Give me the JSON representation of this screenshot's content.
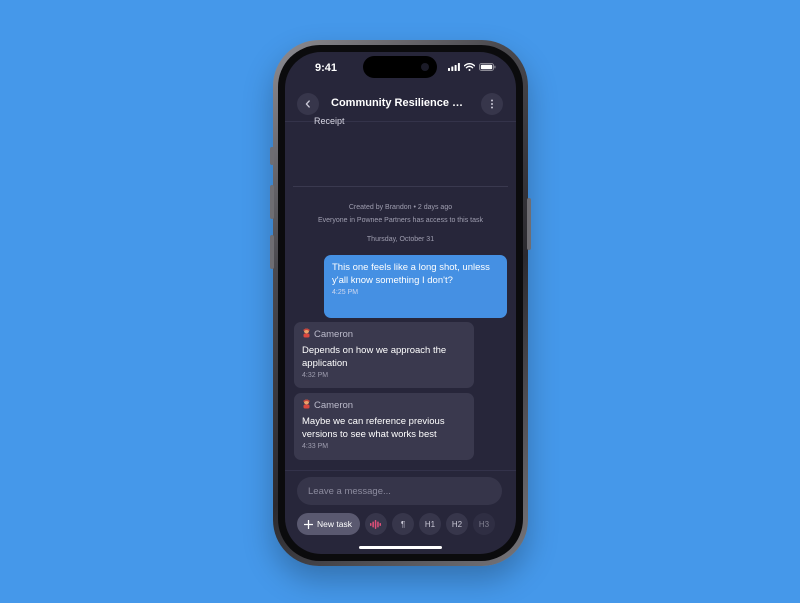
{
  "status_bar": {
    "time": "9:41"
  },
  "header": {
    "title": "Community Resilience & ...",
    "back_icon": "chevron-left-icon",
    "menu_icon": "more-vertical-icon"
  },
  "previous_content": {
    "text": "Receipt"
  },
  "meta": {
    "created": "Created by Brandon  •  2 days ago",
    "access": "Everyone in Pownee Partners has access to this task",
    "date": "Thursday, October 31"
  },
  "messages": [
    {
      "from": "me",
      "text": "This one feels like a long shot, unless y'all know something I don't?",
      "time": "4:25 PM"
    },
    {
      "from": "them",
      "sender": "Cameron",
      "text": "Depends on how we approach the application",
      "time": "4:32 PM"
    },
    {
      "from": "them",
      "sender": "Cameron",
      "text": "Maybe we can reference previous versions to see what works best",
      "time": "4:33 PM"
    }
  ],
  "composer": {
    "placeholder": "Leave a message..."
  },
  "toolbar": {
    "new_task": "New task",
    "paragraph": "¶",
    "h1": "H1",
    "h2": "H2",
    "h3": "H3"
  },
  "colors": {
    "background": "#4598ea",
    "screen": "#27263a",
    "my_bubble": "#4590e3",
    "their_bubble": "#3a394e",
    "voice_accent": "#e2507a"
  }
}
